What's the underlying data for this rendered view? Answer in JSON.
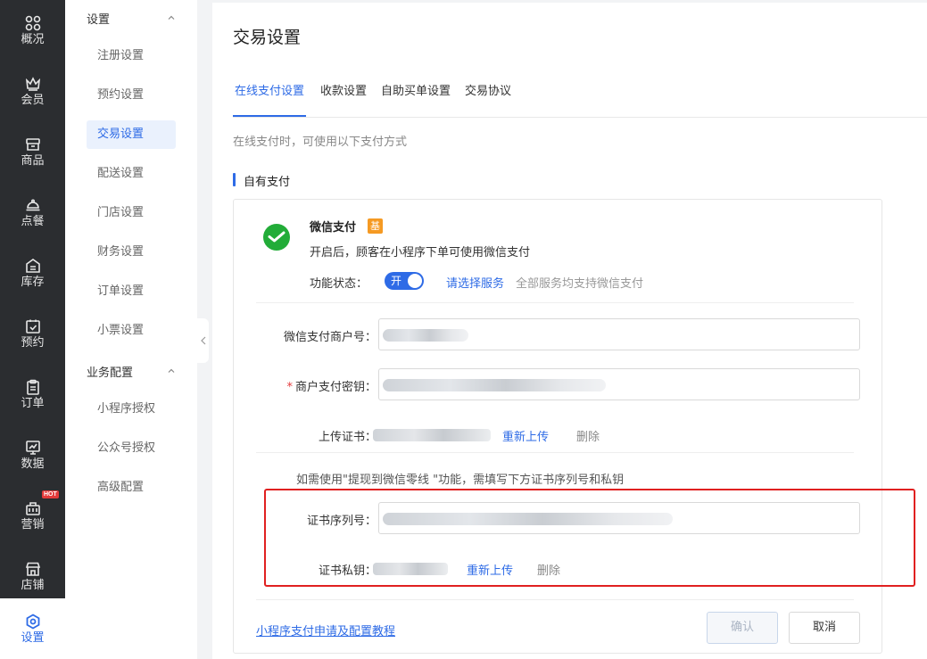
{
  "rail": {
    "items": [
      {
        "label": "概况",
        "icon": "overview-grid-icon"
      },
      {
        "label": "会员",
        "icon": "crown-icon"
      },
      {
        "label": "商品",
        "icon": "store-box-icon"
      },
      {
        "label": "点餐",
        "icon": "cloche-icon"
      },
      {
        "label": "库存",
        "icon": "inventory-icon"
      },
      {
        "label": "预约",
        "icon": "calendar-check-icon"
      },
      {
        "label": "订单",
        "icon": "clipboard-icon"
      },
      {
        "label": "数据",
        "icon": "chart-monitor-icon"
      },
      {
        "label": "营销",
        "icon": "marketing-icon"
      },
      {
        "label": "店铺",
        "icon": "shop-icon"
      },
      {
        "label": "设置",
        "icon": "settings-hex-icon"
      }
    ],
    "hot_badge": "HOT",
    "active_color": "#2e6be6"
  },
  "submenu": {
    "group1": "设置",
    "group1_items": [
      "注册设置",
      "预约设置",
      "交易设置",
      "配送设置",
      "门店设置",
      "财务设置",
      "订单设置",
      "小票设置"
    ],
    "group2": "业务配置",
    "group2_items": [
      "小程序授权",
      "公众号授权",
      "高级配置"
    ]
  },
  "page": {
    "title": "交易设置",
    "tabs": [
      "在线支付设置",
      "收款设置",
      "自助买单设置",
      "交易协议"
    ],
    "tip": "在线支付时，可使用以下支付方式",
    "section_title": "自有支付"
  },
  "wechat_pay": {
    "title": "微信支付",
    "badge": "基",
    "desc": "开启后，顾客在小程序下单可使用微信支付",
    "status_label": "功能状态：",
    "toggle_text": "开",
    "service_link": "请选择服务",
    "service_note": "全部服务均支持微信支付"
  },
  "form": {
    "merchant_id_label": "微信支付商户号：",
    "merchant_key_label": "商户支付密钥：",
    "required_mark": "*",
    "upload_cert_label": "上传证书：",
    "reupload": "重新上传",
    "delete": "删除",
    "note": "如需使用\"提现到微信零线 \"功能，需填写下方证书序列号和私钥",
    "cert_serial_label": "证书序列号：",
    "cert_key_label": "证书私钥：",
    "cert_key_reupload": "重新上传",
    "cert_key_delete": "删除"
  },
  "footer": {
    "tutorial_link": "小程序支付申请及配置教程",
    "confirm": "确认",
    "cancel": "取消"
  }
}
